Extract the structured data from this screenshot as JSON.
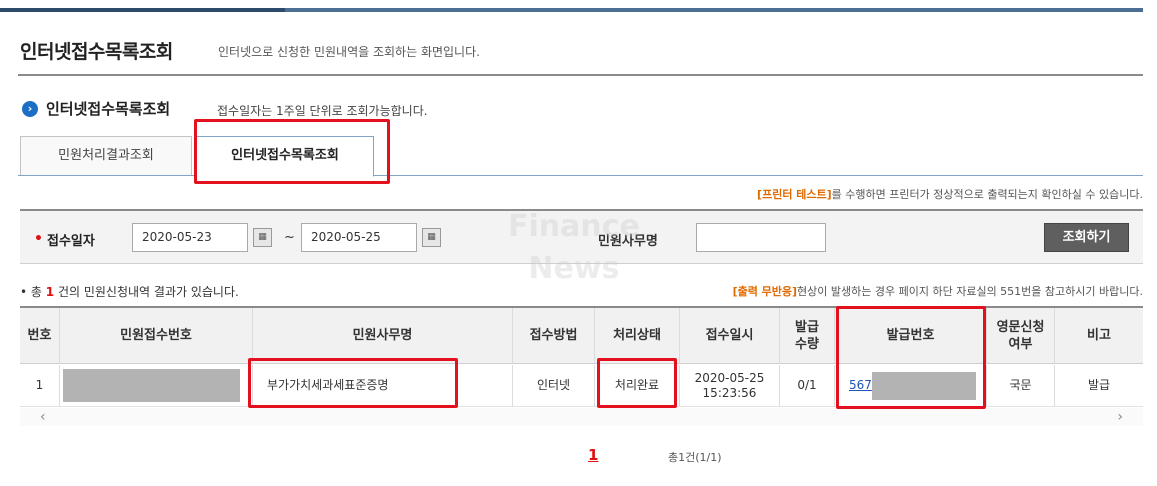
{
  "header": {
    "title": "인터넷접수목록조회",
    "description": "인터넷으로 신청한 민원내역을 조회하는 화면입니다."
  },
  "section": {
    "title": "인터넷접수목록조회",
    "description": "접수일자는 1주일 단위로 조회가능합니다."
  },
  "tabs": [
    {
      "label": "민원처리결과조회"
    },
    {
      "label": "인터넷접수목록조회"
    }
  ],
  "printer_note": {
    "link": "[프린터 테스트]",
    "text": "를 수행하면 프린터가 정상적으로 출력되는지 확인하실 수 있습니다."
  },
  "search": {
    "date_label": "접수일자",
    "date_from": "2020-05-23",
    "date_to": "2020-05-25",
    "tilde": "~",
    "name_label": "민원사무명",
    "name_value": "",
    "button_label": "조회하기"
  },
  "results": {
    "prefix": "• 총",
    "count": "1",
    "suffix": "건의 민원신청내역 결과가 있습니다."
  },
  "report_note": {
    "link": "[출력 무반응]",
    "text": "현상이 발생하는 경우 페이지 하단 자료실의 551번을 참고하시기 바랍니다."
  },
  "table": {
    "headers": {
      "no": "번호",
      "receipt_no": "민원접수번호",
      "name": "민원사무명",
      "method": "접수방법",
      "status": "처리상태",
      "datetime": "접수일시",
      "qty_line1": "발급",
      "qty_line2": "수량",
      "issue_no": "발급번호",
      "eng_line1": "영문신청",
      "eng_line2": "여부",
      "note": "비고"
    },
    "row": {
      "no": "1",
      "name": "부가가치세과세표준증명",
      "method": "인터넷",
      "status": "처리완료",
      "date": "2020-05-25",
      "time": "15:23:56",
      "qty": "0/1",
      "issue_no": "567",
      "lang": "국문",
      "note": "발급"
    },
    "scroll_left": "‹",
    "scroll_right": "›"
  },
  "pagination": {
    "current": "1",
    "total": "총1건(1/1)"
  },
  "watermark": {
    "line1": "Finance",
    "line2": "News"
  },
  "colors": {
    "highlight": "#e3101d",
    "accent": "#1d6fc6",
    "count": "#dd1111",
    "link_note": "#e06a00"
  }
}
